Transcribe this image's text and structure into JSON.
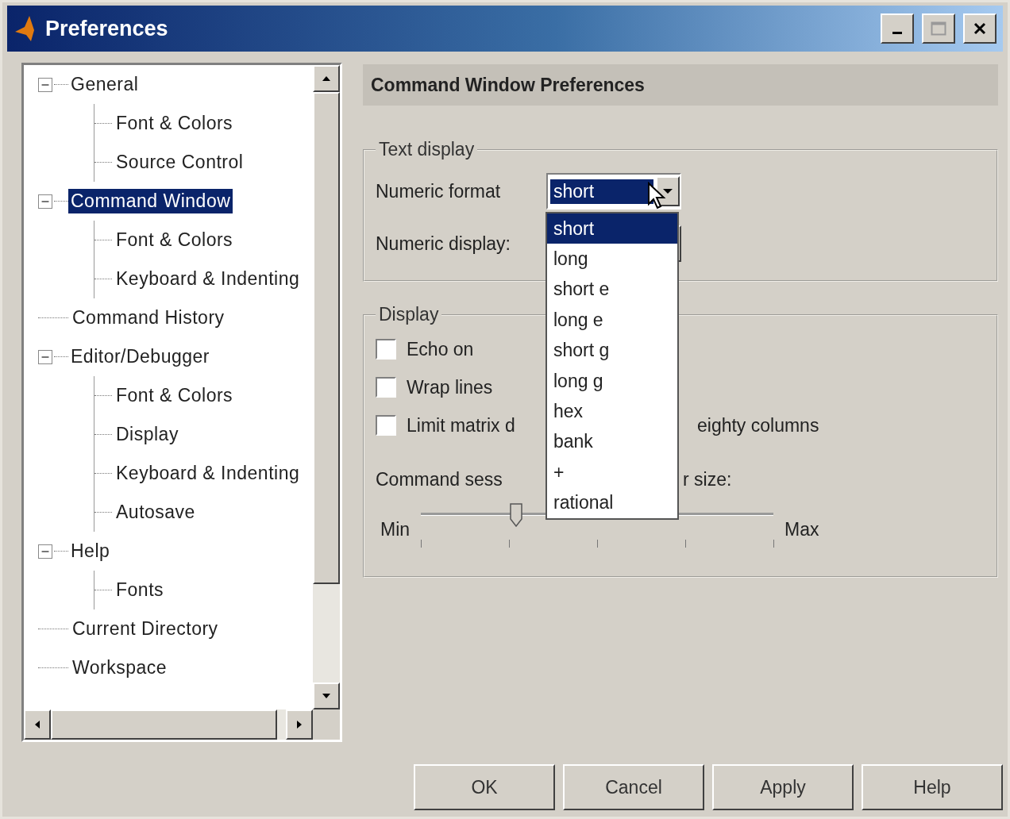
{
  "window": {
    "title": "Preferences"
  },
  "tree": [
    {
      "label": "General",
      "expanded": true,
      "selected": false,
      "children": [
        {
          "label": "Font & Colors",
          "selected": false
        },
        {
          "label": "Source Control",
          "selected": false
        }
      ]
    },
    {
      "label": "Command Window",
      "expanded": true,
      "selected": true,
      "children": [
        {
          "label": "Font & Colors",
          "selected": false
        },
        {
          "label": "Keyboard & Indenting",
          "selected": false
        }
      ]
    },
    {
      "label": "Command History",
      "selected": false
    },
    {
      "label": "Editor/Debugger",
      "expanded": true,
      "selected": false,
      "children": [
        {
          "label": "Font & Colors",
          "selected": false
        },
        {
          "label": "Display",
          "selected": false
        },
        {
          "label": "Keyboard & Indenting",
          "selected": false
        },
        {
          "label": "Autosave",
          "selected": false
        }
      ]
    },
    {
      "label": "Help",
      "expanded": true,
      "selected": false,
      "children": [
        {
          "label": "Fonts",
          "selected": false
        }
      ]
    },
    {
      "label": "Current Directory",
      "selected": false
    },
    {
      "label": "Workspace",
      "selected": false
    }
  ],
  "panel": {
    "title": "Command Window Preferences",
    "text_display": {
      "legend": "Text display",
      "numeric_format": {
        "label": "Numeric format",
        "value": "short"
      },
      "numeric_display": {
        "label": "Numeric display:"
      }
    },
    "format_options": [
      {
        "label": "short",
        "selected": true
      },
      {
        "label": "long",
        "selected": false
      },
      {
        "label": "short e",
        "selected": false
      },
      {
        "label": "long e",
        "selected": false
      },
      {
        "label": "short g",
        "selected": false
      },
      {
        "label": "long g",
        "selected": false
      },
      {
        "label": "hex",
        "selected": false
      },
      {
        "label": "bank",
        "selected": false
      },
      {
        "label": "+",
        "selected": false
      },
      {
        "label": "rational",
        "selected": false
      }
    ],
    "display": {
      "legend": "Display",
      "checkboxes": [
        {
          "label": "Echo on",
          "checked": false
        },
        {
          "label": "Wrap lines",
          "checked": false
        },
        {
          "label": "Limit matrix d",
          "label_end": "eighty columns",
          "checked": false
        }
      ],
      "buffer": {
        "label": "Command sess",
        "label_end": "r size:",
        "min": "Min",
        "max": "Max",
        "level": 0.27
      }
    }
  },
  "buttons": [
    "OK",
    "Cancel",
    "Apply",
    "Help"
  ]
}
